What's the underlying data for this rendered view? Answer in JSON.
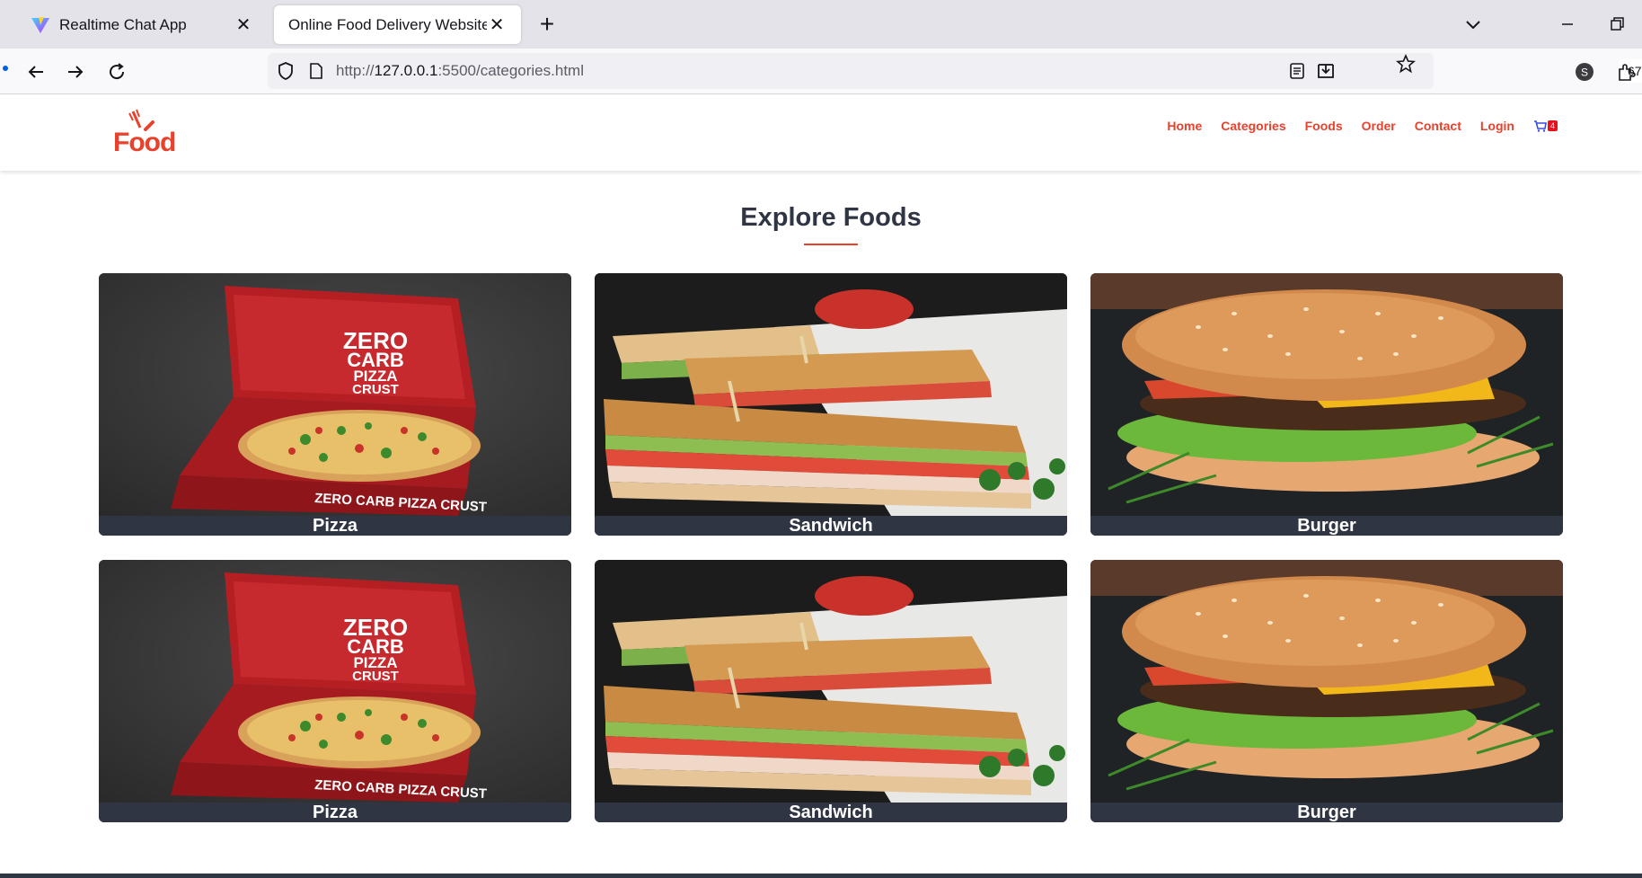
{
  "browser": {
    "tabs": [
      {
        "title": "Realtime Chat App",
        "active": false
      },
      {
        "title": "Online Food Delivery Website",
        "active": true
      }
    ],
    "url_prefix": "http://",
    "url_host": "127.0.0.1",
    "url_rest": ":5500/categories.html",
    "zoom": "67%",
    "profile_initial": "S"
  },
  "site": {
    "logo_text": "Food",
    "nav": [
      "Home",
      "Categories",
      "Foods",
      "Order",
      "Contact",
      "Login"
    ],
    "cart_count": "4",
    "section_title": "Explore Foods",
    "categories": [
      {
        "label": "Pizza",
        "image": "pizza-photo"
      },
      {
        "label": "Sandwich",
        "image": "sandwich-photo"
      },
      {
        "label": "Burger",
        "image": "burger-photo"
      },
      {
        "label": "Pizza",
        "image": "pizza-photo"
      },
      {
        "label": "Sandwich",
        "image": "sandwich-photo"
      },
      {
        "label": "Burger",
        "image": "burger-photo"
      }
    ],
    "pizza_box_text": "ZERO CARB PIZZA CRUST",
    "pizza_lid_lines": [
      "ZERO",
      "CARB",
      "PIZZA",
      "CRUST"
    ],
    "brand_color": "#e8412c",
    "dark_color": "#2f3542"
  }
}
